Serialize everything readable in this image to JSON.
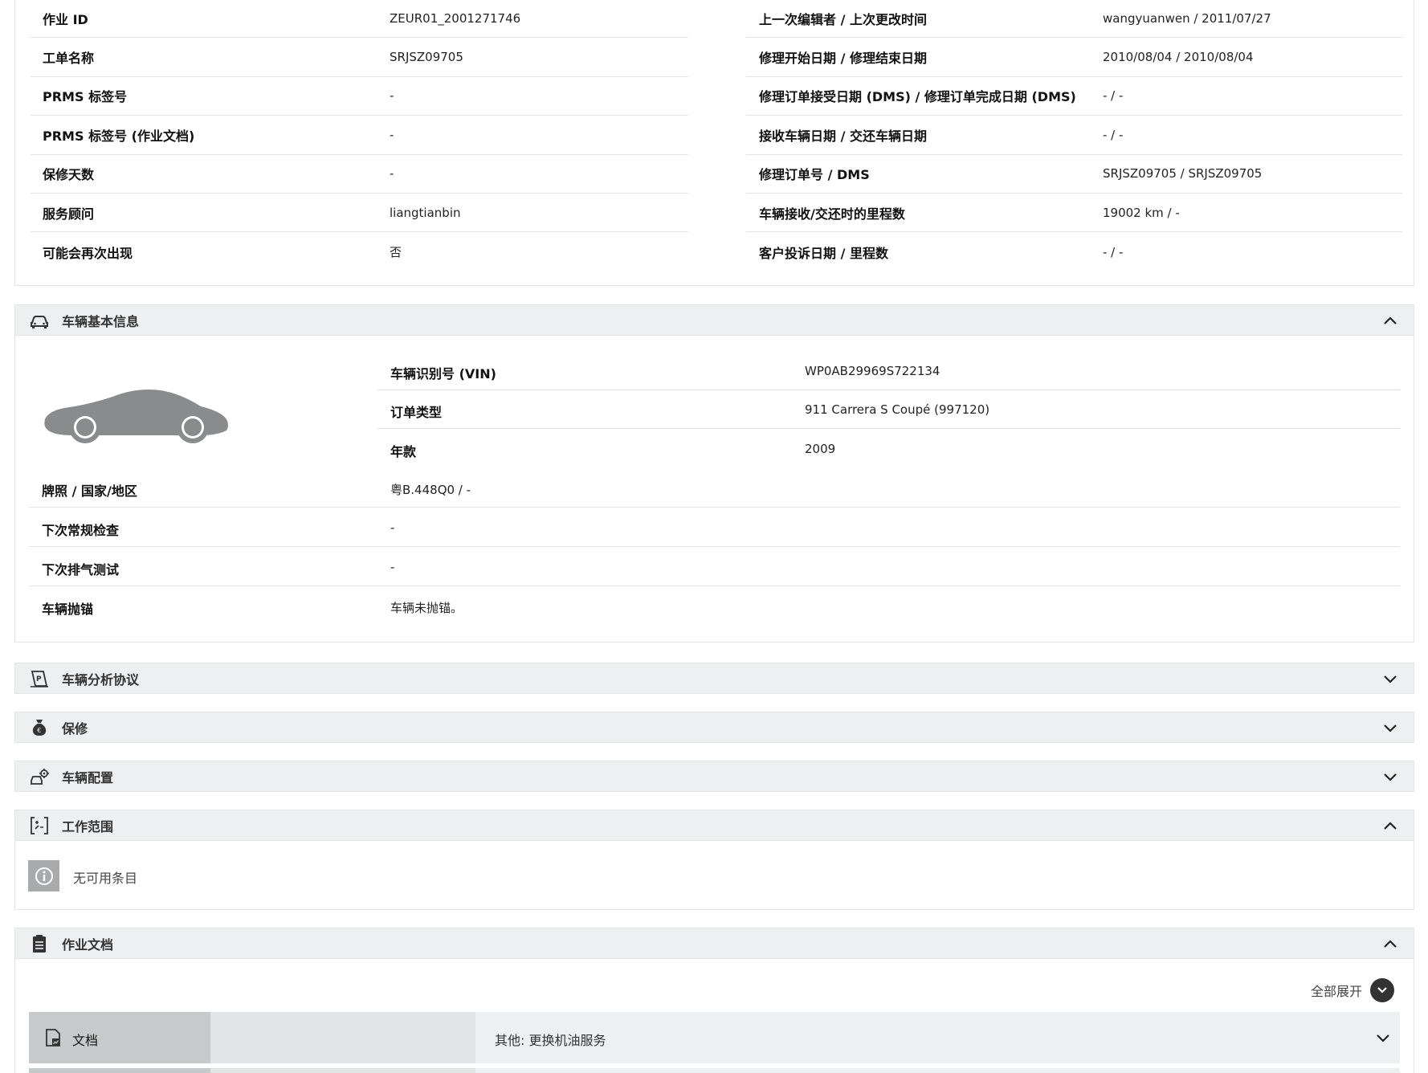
{
  "job_info": {
    "left": [
      {
        "label": "作业 ID",
        "value": "ZEUR01_2001271746"
      },
      {
        "label": "工单名称",
        "value": "SRJSZ09705"
      },
      {
        "label": "PRMS 标签号",
        "value": "-"
      },
      {
        "label": "PRMS 标签号 (作业文档)",
        "value": "-"
      },
      {
        "label": "保修天数",
        "value": "-"
      },
      {
        "label": "服务顾问",
        "value": "liangtianbin"
      },
      {
        "label": "可能会再次出现",
        "value": "否"
      }
    ],
    "right": [
      {
        "label": "上一次编辑者 / 上次更改时间",
        "value": "wangyuanwen / 2011/07/27"
      },
      {
        "label": "修理开始日期 / 修理结束日期",
        "value": "2010/08/04 / 2010/08/04"
      },
      {
        "label": "修理订单接受日期 (DMS) / 修理订单完成日期 (DMS)",
        "value": "- / -"
      },
      {
        "label": "接收车辆日期 / 交还车辆日期",
        "value": "- / -"
      },
      {
        "label": "修理订单号 / DMS",
        "value": "SRJSZ09705 / SRJSZ09705"
      },
      {
        "label": "车辆接收/交还时的里程数",
        "value": "19002 km / -"
      },
      {
        "label": "客户投诉日期 / 里程数",
        "value": "- / -"
      }
    ]
  },
  "sections": {
    "vehicle_info": {
      "title": "车辆基本信息",
      "icon": "car-icon",
      "expanded": true
    },
    "analysis": {
      "title": "车辆分析协议",
      "icon": "protocol-icon",
      "expanded": false
    },
    "warranty": {
      "title": "保修",
      "icon": "money-bag-icon",
      "expanded": false
    },
    "config": {
      "title": "车辆配置",
      "icon": "car-config-icon",
      "expanded": false
    },
    "scope": {
      "title": "工作范围",
      "icon": "scope-icon",
      "expanded": true
    },
    "docs": {
      "title": "作业文档",
      "icon": "clipboard-icon",
      "expanded": true
    }
  },
  "vehicle": {
    "top_rows": [
      {
        "label": "车辆识别号 (VIN)",
        "value": "WP0AB29969S722134"
      },
      {
        "label": "订单类型",
        "value": "911 Carrera S Coupé (997120)"
      },
      {
        "label": "年款",
        "value": "2009"
      }
    ],
    "bottom_rows": [
      {
        "label": "牌照 / 国家/地区",
        "value": "粤B.448Q0 / -"
      },
      {
        "label": "下次常规检查",
        "value": "-"
      },
      {
        "label": "下次排气测试",
        "value": "-"
      },
      {
        "label": "车辆抛锚",
        "value": "车辆未抛锚。"
      }
    ]
  },
  "scope": {
    "empty_text": "无可用条目"
  },
  "docs": {
    "expand_all_label": "全部展开",
    "rows": [
      {
        "tab_label": "文档",
        "description": "其他: 更换机油服务"
      }
    ]
  },
  "colors": {
    "header_bg": "#eeeff0",
    "border": "#e3e4e5",
    "tab_active": "#c8c9ca",
    "info_icon_bg": "#a9aaab"
  }
}
